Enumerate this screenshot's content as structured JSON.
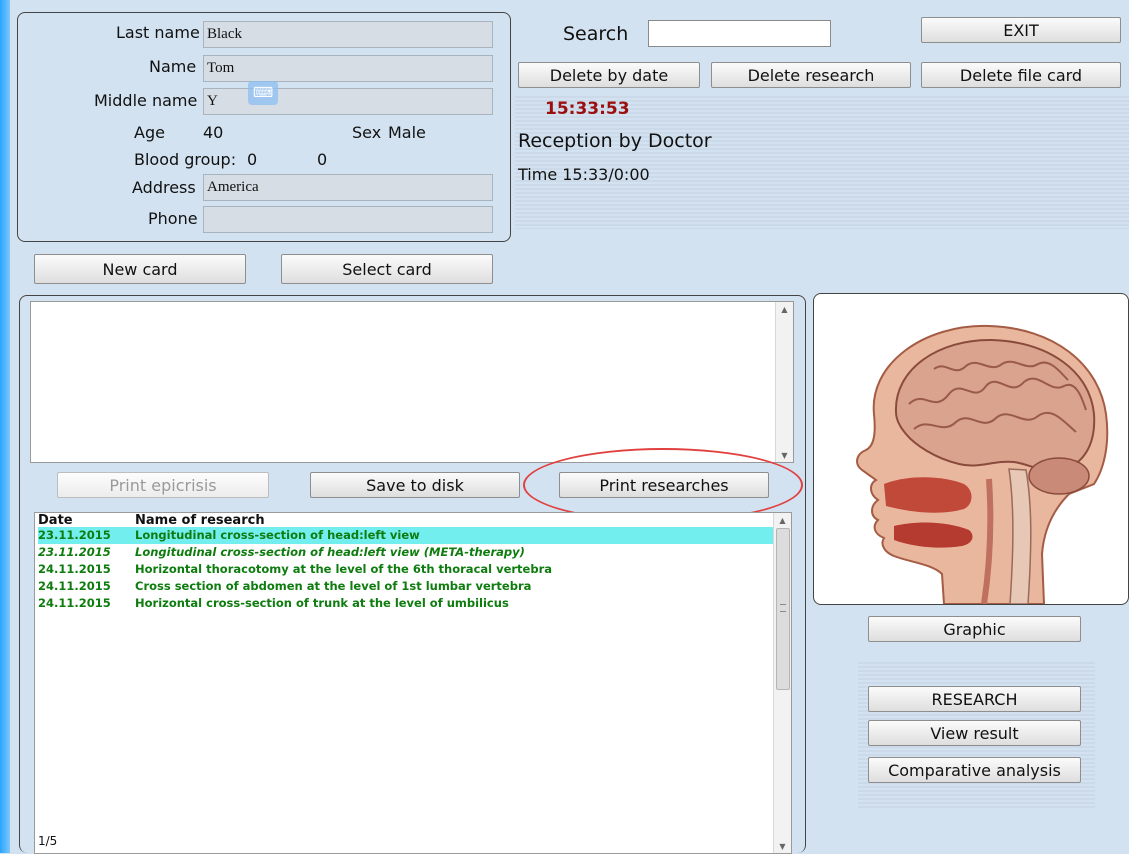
{
  "patient": {
    "last_name_label": "Last name",
    "last_name": "Black",
    "name_label": "Name",
    "name": "Tom",
    "middle_name_label": "Middle name",
    "middle_name": "Y",
    "age_label": "Age",
    "age": "40",
    "sex_label": "Sex",
    "sex": "Male",
    "blood_group_label": "Blood group:",
    "blood_group_1": "0",
    "blood_group_2": "0",
    "address_label": "Address",
    "address": "America",
    "phone_label": "Phone",
    "phone": ""
  },
  "actions": {
    "search_label": "Search",
    "search_value": "",
    "exit": "EXIT",
    "delete_by_date": "Delete by date",
    "delete_research": "Delete research",
    "delete_file_card": "Delete file card",
    "new_card": "New card",
    "select_card": "Select card"
  },
  "status": {
    "clock": "15:33:53",
    "reception": "Reception by Doctor",
    "time": "Time 15:33/0:00"
  },
  "epicrisis": {
    "text": "",
    "print_epicrisis": "Print epicrisis",
    "save_to_disk": "Save to disk",
    "print_researches": "Print researches"
  },
  "research_list": {
    "col_date": "Date",
    "col_name": "Name of research",
    "rows": [
      {
        "date": "23.11.2015",
        "name": "Longitudinal cross-section of head:left view"
      },
      {
        "date": "23.11.2015",
        "name": "Longitudinal cross-section of head:left view (META-therapy)"
      },
      {
        "date": "24.11.2015",
        "name": "Horizontal thoracotomy at the level of the 6th thoracal vertebra"
      },
      {
        "date": "24.11.2015",
        "name": "Cross section of abdomen at the level of 1st lumbar vertebra"
      },
      {
        "date": "24.11.2015",
        "name": "Horizontal cross-section of trunk at the level of umbilicus"
      }
    ],
    "pager": "1/5"
  },
  "right_panel": {
    "graphic": "Graphic",
    "research": "RESEARCH",
    "view_result": "View result",
    "comparative_analysis": "Comparative analysis"
  },
  "colors": {
    "background": "#d3e2f1",
    "clock": "#9b0f0f",
    "row_text": "#0e7c0e",
    "row_selected": "#72eeee",
    "highlight_ellipse": "#e0413f"
  }
}
